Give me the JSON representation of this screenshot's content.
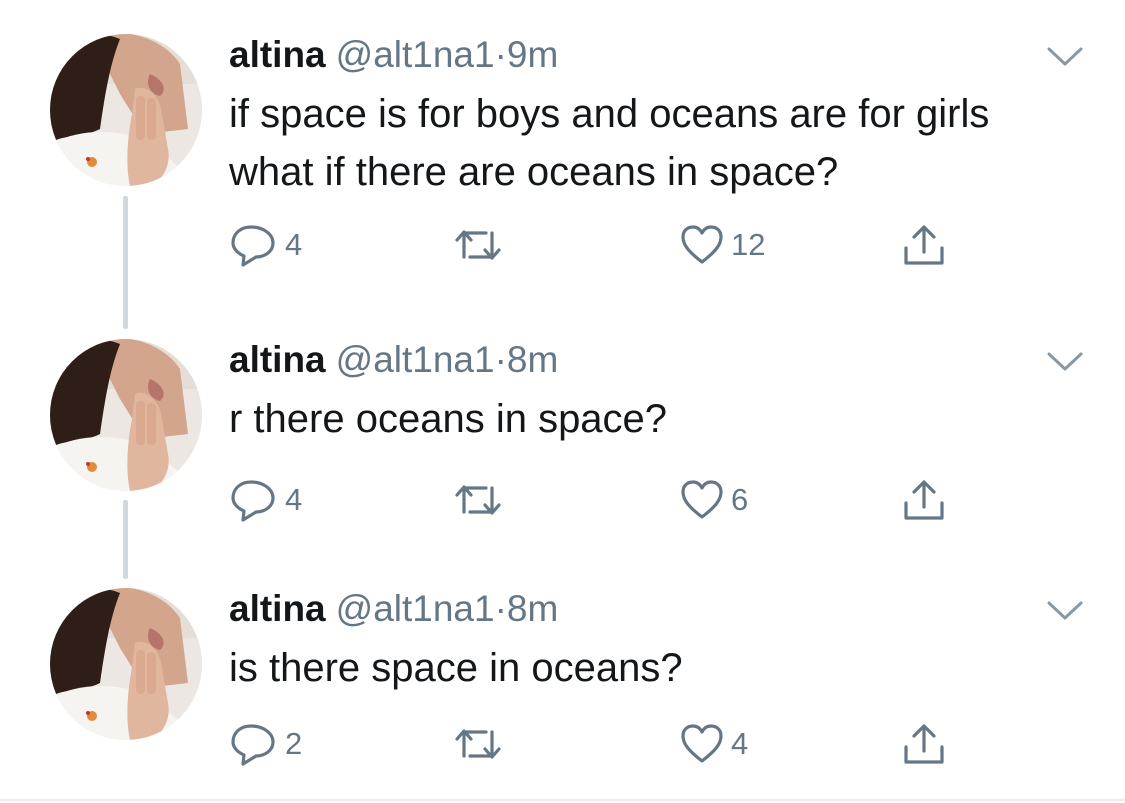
{
  "colors": {
    "text_primary": "#14171a",
    "text_secondary": "#657786",
    "thread_line": "#cfd9de"
  },
  "icons": {
    "reply": "speech-bubble-icon",
    "retweet": "retweet-arrows-icon",
    "like": "heart-outline-icon",
    "share": "share-up-arrow-icon",
    "menu": "chevron-down-icon"
  },
  "tweets": [
    {
      "display_name": "altina",
      "handle": "@alt1na1",
      "separator": "·",
      "time": "9m",
      "text": "if space is for boys and oceans are for girls what if there are oceans in space?",
      "replies": "4",
      "retweets": "",
      "likes": "12"
    },
    {
      "display_name": "altina",
      "handle": "@alt1na1",
      "separator": "·",
      "time": "8m",
      "text": "r there oceans in space?",
      "replies": "4",
      "retweets": "",
      "likes": "6"
    },
    {
      "display_name": "altina",
      "handle": "@alt1na1",
      "separator": "·",
      "time": "8m",
      "text": "is there space in oceans?",
      "replies": "2",
      "retweets": "",
      "likes": "4"
    }
  ]
}
